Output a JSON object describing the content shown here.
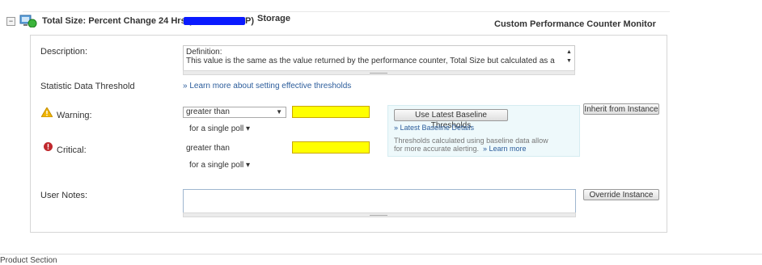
{
  "header": {
    "collapse_symbol": "−",
    "title": "Total Size: Percent Change 24 Hrs (",
    "title_tail": "P)",
    "storage": "Storage",
    "monitor_type": "Custom Performance Counter Monitor"
  },
  "description": {
    "label": "Description:",
    "line1": "Definition:",
    "line2": "This value is the same as the value returned by the performance counter, Total Size but calculated as a",
    "scroll_up": "▲",
    "scroll_down": "▼"
  },
  "threshold": {
    "label": "Statistic Data Threshold",
    "learn_link": "» Learn more about setting effective thresholds"
  },
  "warning": {
    "label": "Warning:",
    "operator": "greater than",
    "dropdown_arrow": "▼",
    "poll": "for a single poll ▾",
    "value": ""
  },
  "critical": {
    "label": "Critical:",
    "operator": "greater than",
    "poll": "for a single poll ▾",
    "value": ""
  },
  "baseline": {
    "button": "Use Latest Baseline Thresholds",
    "details_link": "» Latest Baseline Details",
    "info_line1": "Thresholds calculated using baseline data allow",
    "info_line2": "for more accurate alerting.",
    "learn_more": "» Learn more"
  },
  "buttons": {
    "inherit": "Inherit from Instance",
    "override": "Override Instance"
  },
  "user_notes": {
    "label": "User Notes:",
    "value": ""
  },
  "footer": {
    "section": "Product Section"
  },
  "colors": {
    "link": "#2b5c9b",
    "threshold_field": "#ffff00",
    "warning_icon": "#f0b400",
    "critical_icon": "#c0282d"
  }
}
